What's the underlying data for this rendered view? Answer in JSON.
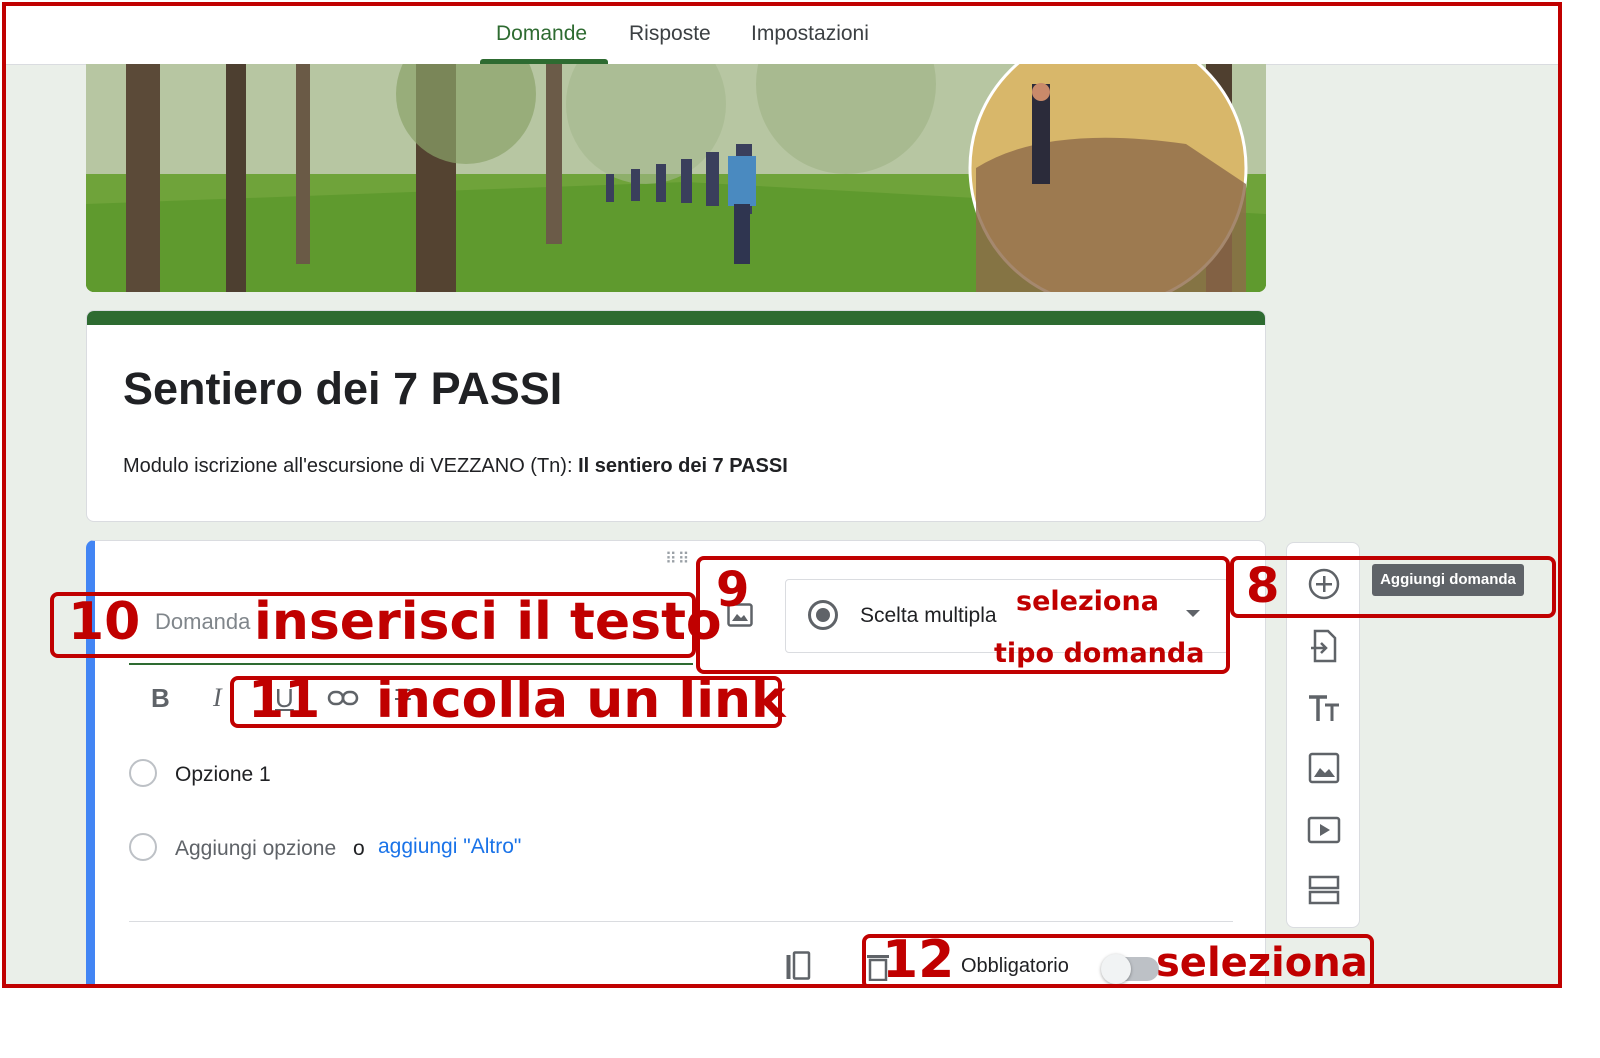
{
  "tabs": [
    {
      "label": "Domande",
      "active": true
    },
    {
      "label": "Risposte",
      "active": false
    },
    {
      "label": "Impostazioni",
      "active": false
    }
  ],
  "form": {
    "title": "Sentiero dei 7 PASSI",
    "description_prefix": "Modulo iscrizione all'escursione di VEZZANO (Tn): ",
    "description_bold": "Il sentiero dei 7 PASSI"
  },
  "question": {
    "placeholder": "Domanda",
    "type_label": "Scelta multipla",
    "options": [
      "Opzione 1"
    ],
    "add_option": "Aggiungi opzione",
    "or_label": "o",
    "add_other": "aggiungi \"Altro\"",
    "required_label": "Obbligatorio"
  },
  "toolbar": {
    "tooltip": "Aggiungi domanda"
  },
  "annotations": {
    "n8": "8",
    "n9": "9",
    "t9a": "seleziona",
    "t9b": "tipo domanda",
    "n10": "10",
    "t10": "inserisci il testo",
    "n11": "11",
    "t11": "incolla un link",
    "n12": "12",
    "t12": "seleziona"
  },
  "colors": {
    "accent_green": "#2e6b31",
    "annotation_red": "#c00000",
    "question_blue": "#4285f4",
    "link_blue": "#1a73e8"
  }
}
